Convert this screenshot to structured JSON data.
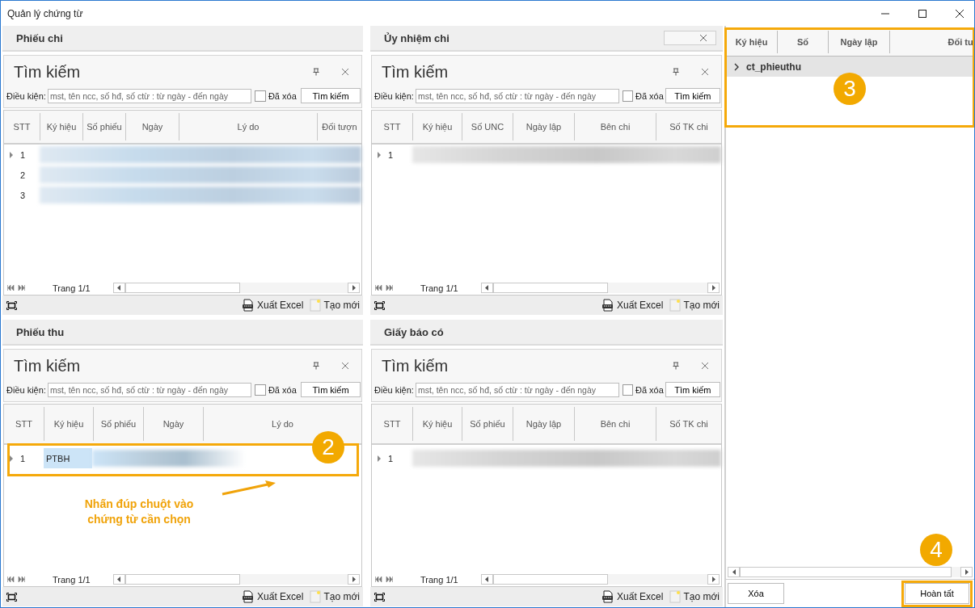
{
  "window": {
    "title": "Quản lý chứng từ"
  },
  "panels": [
    {
      "title": "Phiếu chi",
      "closable": false,
      "search": {
        "title": "Tìm kiếm",
        "label": "Điều kiện:",
        "placeholder": "mst, tên ncc, số hđ, số ctừ : từ ngày - đến ngày",
        "deleted_label": "Đã xóa",
        "deleted_checked": false,
        "button": "Tìm kiếm"
      },
      "columns": [
        "STT",
        "Ký hiệu",
        "Số phiếu",
        "Ngày",
        "Lý do",
        "Đối tượn"
      ],
      "rows": [
        {
          "cells": [
            "1"
          ],
          "current": true,
          "selected": true,
          "redacted": true
        },
        {
          "cells": [
            "2"
          ],
          "current": false,
          "selected": true,
          "redacted": true
        },
        {
          "cells": [
            "3"
          ],
          "current": false,
          "selected": true,
          "redacted": true
        }
      ],
      "pager": "Trang 1/1",
      "actions": [
        "Xuất Excel",
        "Tạo mới"
      ]
    },
    {
      "title": "Ủy nhiệm chi",
      "closable": true,
      "search": {
        "title": "Tìm kiếm",
        "label": "Điều kiện:",
        "placeholder": "mst, tên ncc, số hđ, số ctừ : từ ngày - đến ngày",
        "deleted_label": "Đã xóa",
        "deleted_checked": false,
        "button": "Tìm kiếm"
      },
      "columns": [
        "STT",
        "Ký hiệu",
        "Số UNC",
        "Ngày lập",
        "Bên chi",
        "Số TK chi"
      ],
      "rows": [
        {
          "cells": [
            "1"
          ],
          "current": true,
          "selected": false,
          "redacted": true
        }
      ],
      "pager": "Trang 1/1",
      "actions": [
        "Xuất Excel",
        "Tạo mới"
      ]
    },
    {
      "title": "Phiếu thu",
      "closable": false,
      "search": {
        "title": "Tìm kiếm",
        "label": "Điều kiện:",
        "placeholder": "mst, tên ncc, số hđ, số ctừ : từ ngày - đến ngày",
        "deleted_label": "Đã xóa",
        "deleted_checked": false,
        "button": "Tìm kiếm"
      },
      "columns": [
        "STT",
        "Ký hiệu",
        "Số phiếu",
        "Ngày",
        "Lý do"
      ],
      "rows": [
        {
          "cells": [
            "1",
            "PTBH"
          ],
          "current": true,
          "selected": true,
          "redacted": true
        }
      ],
      "pager": "Trang 1/1",
      "actions": [
        "Xuất Excel",
        "Tạo mới"
      ]
    },
    {
      "title": "Giấy báo có",
      "closable": false,
      "search": {
        "title": "Tìm kiếm",
        "label": "Điều kiện:",
        "placeholder": "mst, tên ncc, số hđ, số ctừ : từ ngày - đến ngày",
        "deleted_label": "Đã xóa",
        "deleted_checked": false,
        "button": "Tìm kiếm"
      },
      "columns": [
        "STT",
        "Ký hiệu",
        "Số phiếu",
        "Ngày lập",
        "Bên chi",
        "Số TK chi"
      ],
      "rows": [
        {
          "cells": [
            "1"
          ],
          "current": true,
          "selected": false,
          "redacted": true
        }
      ],
      "pager": "Trang 1/1",
      "actions": [
        "Xuất Excel",
        "Tạo mới"
      ]
    }
  ],
  "selection": {
    "columns": [
      "Ký hiệu",
      "Số",
      "Ngày lập",
      "Đối tư"
    ],
    "groups": [
      {
        "label": "ct_phieuthu",
        "expanded": false
      }
    ],
    "buttons": [
      "Xóa",
      "Hoàn tất"
    ]
  },
  "annotations": {
    "hint": "Nhấn đúp chuột vào chứng từ cần chọn",
    "steps": [
      "2",
      "3",
      "4"
    ]
  }
}
